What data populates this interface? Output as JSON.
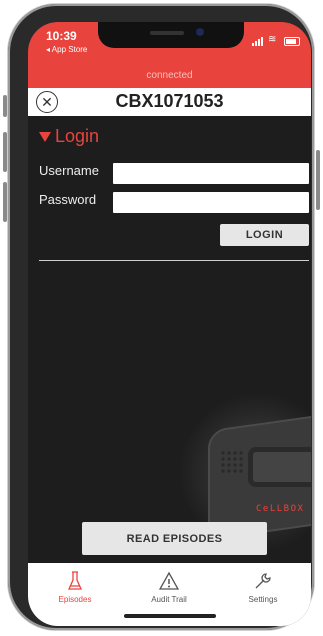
{
  "statusbar": {
    "time": "10:39",
    "back_app": "◂ App Store",
    "connection": "connected"
  },
  "device": {
    "title": "CBX1071053"
  },
  "login": {
    "header": "Login",
    "username_label": "Username",
    "username_value": "",
    "password_label": "Password",
    "password_value": "",
    "login_button": "LOGIN"
  },
  "hero": {
    "brand_logo": "CeLLBOX"
  },
  "actions": {
    "read_episodes": "READ EPISODES"
  },
  "tabs": [
    {
      "label": "Episodes",
      "icon": "flask-icon",
      "active": true
    },
    {
      "label": "Audit Trail",
      "icon": "warning-icon",
      "active": false
    },
    {
      "label": "Settings",
      "icon": "wrench-icon",
      "active": false
    }
  ],
  "colors": {
    "accent": "#e8433d",
    "background": "#1d1d1d",
    "button": "#e6e6e6"
  }
}
